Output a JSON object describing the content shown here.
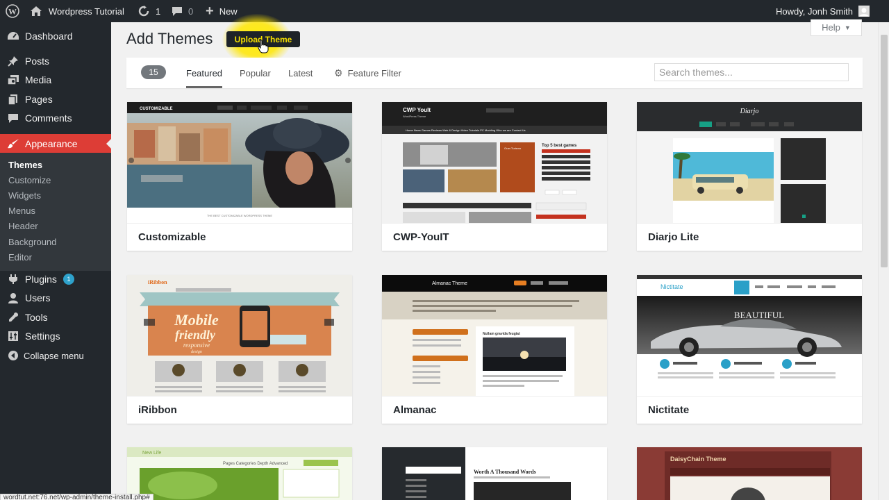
{
  "adminbar": {
    "site_name": "Wordpress Tutorial",
    "updates_count": "1",
    "comments_count": "0",
    "new_label": "New",
    "greeting": "Howdy, Jonh Smith"
  },
  "sidebar": {
    "items": [
      {
        "label": "Dashboard",
        "icon": "dashboard-icon"
      },
      {
        "label": "Posts",
        "icon": "pin-icon"
      },
      {
        "label": "Media",
        "icon": "media-icon"
      },
      {
        "label": "Pages",
        "icon": "pages-icon"
      },
      {
        "label": "Comments",
        "icon": "comment-icon"
      },
      {
        "label": "Appearance",
        "icon": "brush-icon"
      },
      {
        "label": "Plugins",
        "icon": "plug-icon",
        "badge": "1"
      },
      {
        "label": "Users",
        "icon": "user-icon"
      },
      {
        "label": "Tools",
        "icon": "wrench-icon"
      },
      {
        "label": "Settings",
        "icon": "settings-icon"
      },
      {
        "label": "Collapse menu",
        "icon": "collapse-icon"
      }
    ],
    "submenu": [
      "Themes",
      "Customize",
      "Widgets",
      "Menus",
      "Header",
      "Background",
      "Editor"
    ],
    "accent_color": "#dd3d36"
  },
  "main": {
    "title": "Add Themes",
    "upload_button": "Upload Theme",
    "help_label": "Help",
    "theme_count": "15",
    "tabs": [
      "Featured",
      "Popular",
      "Latest"
    ],
    "feature_filter": "Feature Filter",
    "search_placeholder": "Search themes...",
    "themes": [
      {
        "name": "Customizable"
      },
      {
        "name": "CWP-YouIT"
      },
      {
        "name": "Diarjo Lite"
      },
      {
        "name": "iRibbon"
      },
      {
        "name": "Almanac"
      },
      {
        "name": "Nictitate"
      }
    ]
  },
  "previews": {
    "customizable_logo": "CUSTOMIZABLE",
    "customizable_tagline": "THE BEST CUSTOMIZABLE WORDPRESS THEME",
    "cwp_title": "CWP YouIt",
    "cwp_subtitle": "WordPress Theme",
    "cwp_top5": "Top 5 best games",
    "cwp_nav": "Home   News   Games   Reviews   Web & Design   Video Tutorials   PC Modding   Who we are   Contact Us",
    "cwp_promo": "Gran Turismo",
    "diarjo_title": "Diarjo",
    "iribbon_logo": "iRibbon",
    "iribbon_headline1": "Mobile",
    "iribbon_headline2": "friendly",
    "iribbon_headline3": "responsive",
    "iribbon_headline4": "design",
    "almanac_title": "Almanac Theme",
    "almanac_post": "Nullam gravida feugiat",
    "nictitate_logo": "Nictitate",
    "nictitate_hero": "BEAUTIFUL",
    "newlife_title": "New Life",
    "newlife_nav": "Pages   Categories   Depth   Advanced",
    "worth_title": "Worth A Thousand Words",
    "daisychain_title": "DaisyChain Theme"
  },
  "status_url": "wordtut.net:76.net/wp-admin/theme-install.php#"
}
